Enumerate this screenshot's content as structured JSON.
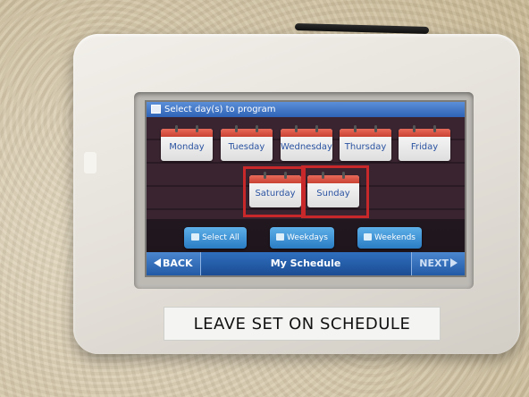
{
  "window": {
    "title": "Select day(s) to program"
  },
  "days": {
    "mon": "Monday",
    "tue": "Tuesday",
    "wed": "Wednesday",
    "thu": "Thursday",
    "fri": "Friday",
    "sat": "Saturday",
    "sun": "Sunday"
  },
  "selected_days": [
    "Saturday",
    "Sunday"
  ],
  "quick_select": {
    "all": "Select All",
    "weekdays": "Weekdays",
    "weekends": "Weekends"
  },
  "nav": {
    "back": "BACK",
    "schedule_name": "My Schedule",
    "next": "NEXT"
  },
  "label": {
    "text": "LEAVE SET ON SCHEDULE"
  },
  "colors": {
    "title_bar": "#2e63b6",
    "day_header": "#c94232",
    "selection_outline": "#c8282a",
    "day_text": "#2b54a2"
  }
}
